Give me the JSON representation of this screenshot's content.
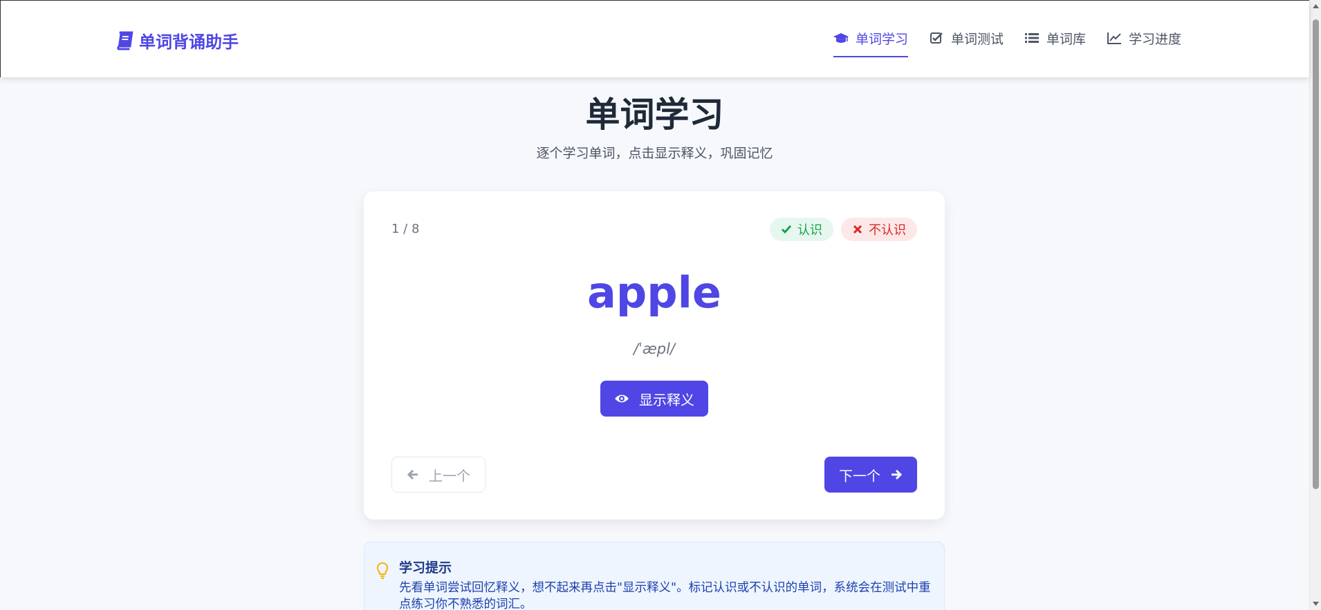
{
  "header": {
    "logo_text": "单词背诵助手",
    "nav": [
      {
        "label": "单词学习",
        "icon": "graduation-cap-icon",
        "active": true
      },
      {
        "label": "单词测试",
        "icon": "check-square-icon",
        "active": false
      },
      {
        "label": "单词库",
        "icon": "list-icon",
        "active": false
      },
      {
        "label": "学习进度",
        "icon": "line-chart-icon",
        "active": false
      }
    ]
  },
  "page": {
    "title": "单词学习",
    "subtitle": "逐个学习单词，点击显示释义，巩固记忆"
  },
  "card": {
    "counter": "1 / 8",
    "known_label": "认识",
    "unknown_label": "不认识",
    "word": "apple",
    "phonetic": "/ˈæpl/",
    "show_meaning_label": "显示释义",
    "prev_label": "上一个",
    "next_label": "下一个"
  },
  "tips": {
    "title": "学习提示",
    "text": "先看单词尝试回忆释义，想不起来再点击\"显示释义\"。标记认识或不认识的单词，系统会在测试中重点练习你不熟悉的词汇。"
  },
  "colors": {
    "accent": "#4f46e5",
    "known": "#16a34a",
    "unknown": "#dc2626",
    "tip_icon": "#f5b400"
  }
}
